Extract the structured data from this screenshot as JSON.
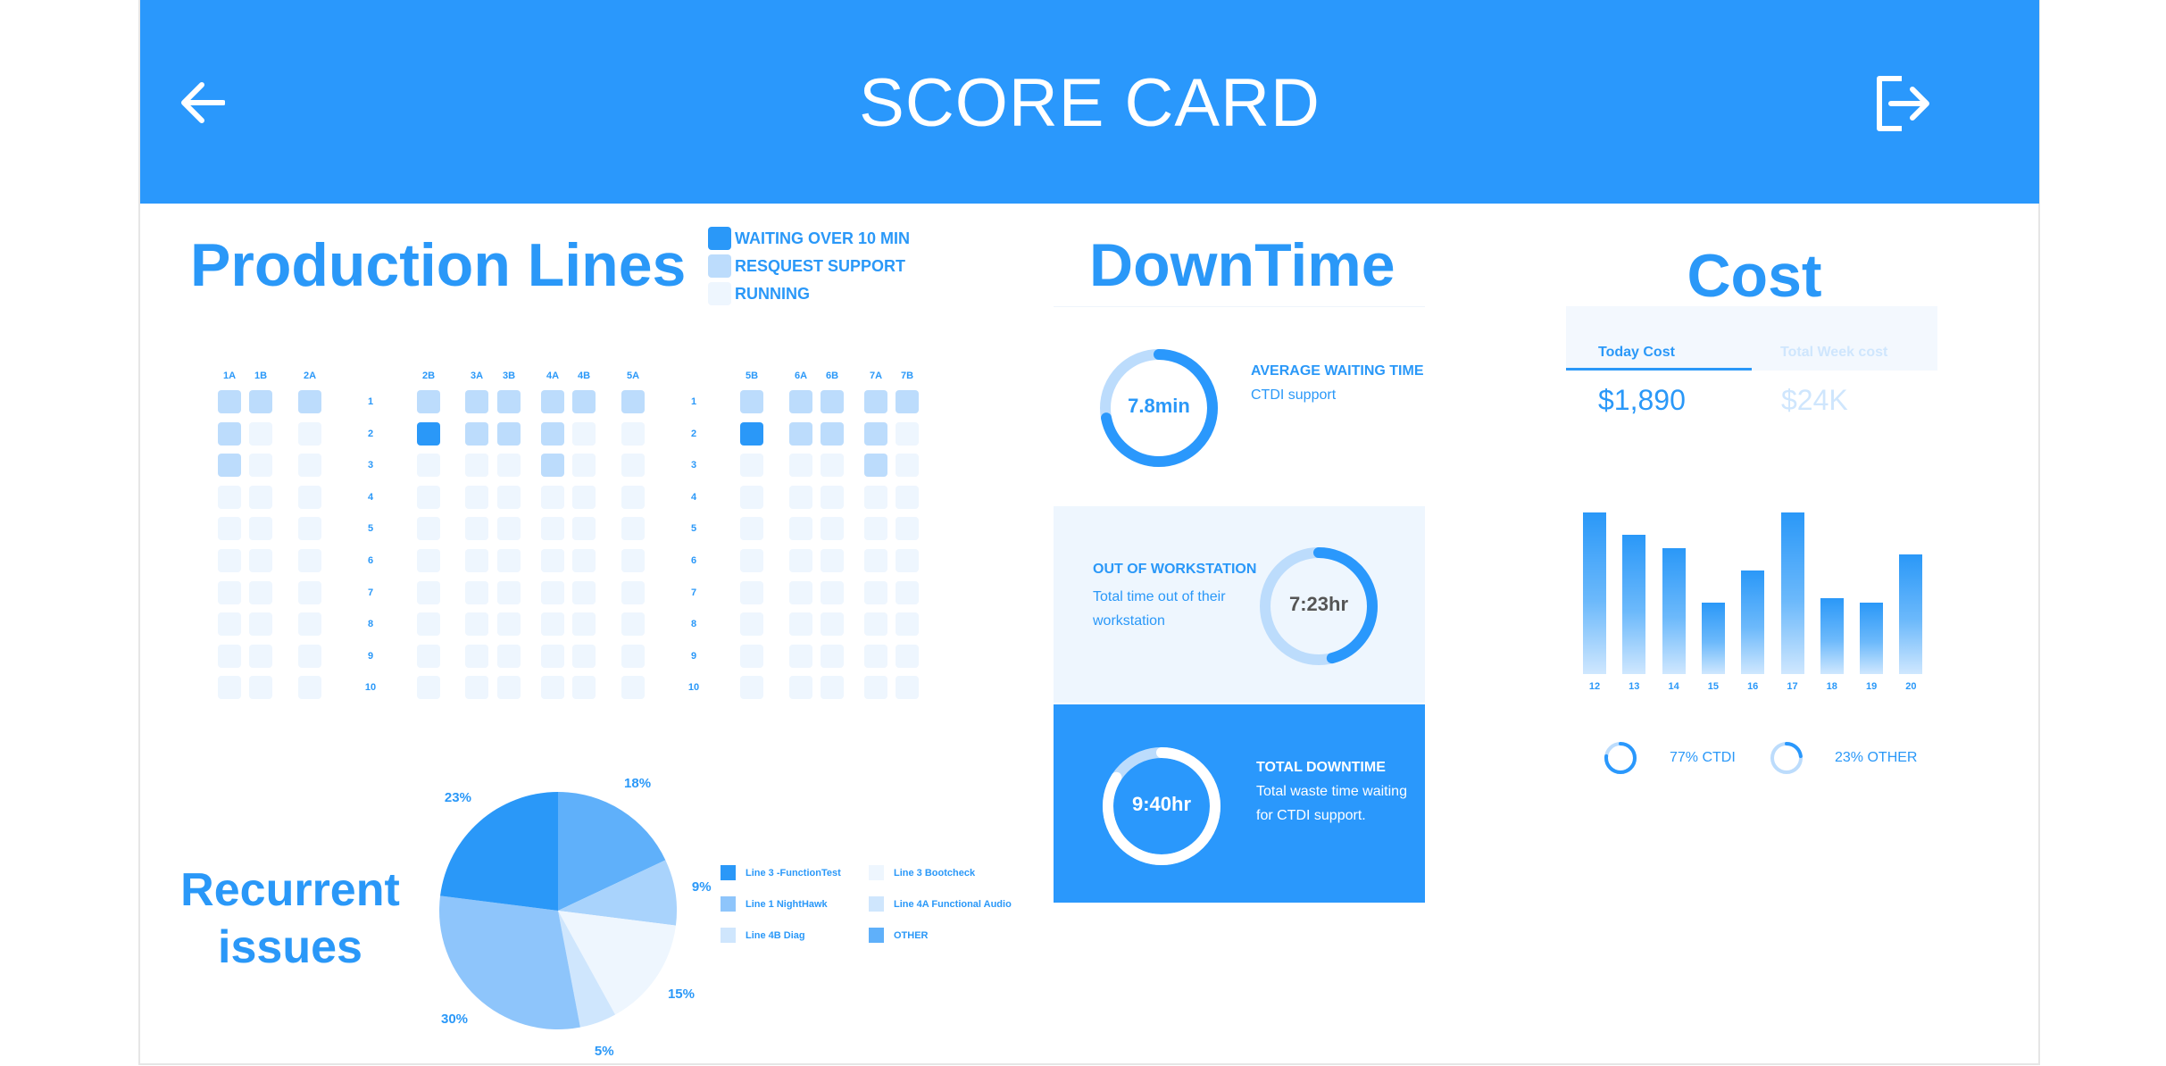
{
  "header": {
    "title": "SCORE CARD",
    "back_icon": "arrow-left-icon",
    "exit_icon": "logout-icon"
  },
  "colors": {
    "primary": "#2a98fc",
    "waiting": "#2a98f8",
    "request": "#bcdcfc",
    "running": "#eef6fe"
  },
  "production": {
    "title": "Production Lines",
    "legend": [
      {
        "label": "WAITING OVER 10 MIN",
        "status": "waiting"
      },
      {
        "label": "RESQUEST SUPPORT",
        "status": "request"
      },
      {
        "label": "RUNNING",
        "status": "running"
      }
    ],
    "row_numbers": [
      "1",
      "2",
      "3",
      "4",
      "5",
      "6",
      "7",
      "8",
      "9",
      "10"
    ],
    "groups": [
      {
        "columns": [
          {
            "label": "1A",
            "status": [
              "request",
              "request",
              "request",
              "running",
              "running",
              "running",
              "running",
              "running",
              "running",
              "running"
            ]
          },
          {
            "label": "1B",
            "status": [
              "request",
              "running",
              "running",
              "running",
              "running",
              "running",
              "running",
              "running",
              "running",
              "running"
            ]
          },
          {
            "label": "2A",
            "status": [
              "request",
              "running",
              "running",
              "running",
              "running",
              "running",
              "running",
              "running",
              "running",
              "running"
            ]
          }
        ]
      },
      {
        "columns": [
          {
            "label": "2B",
            "status": [
              "request",
              "waiting",
              "running",
              "running",
              "running",
              "running",
              "running",
              "running",
              "running",
              "running"
            ]
          },
          {
            "label": "3A",
            "status": [
              "request",
              "request",
              "running",
              "running",
              "running",
              "running",
              "running",
              "running",
              "running",
              "running"
            ]
          },
          {
            "label": "3B",
            "status": [
              "request",
              "request",
              "running",
              "running",
              "running",
              "running",
              "running",
              "running",
              "running",
              "running"
            ]
          },
          {
            "label": "4A",
            "status": [
              "request",
              "request",
              "request",
              "running",
              "running",
              "running",
              "running",
              "running",
              "running",
              "running"
            ]
          },
          {
            "label": "4B",
            "status": [
              "request",
              "running",
              "running",
              "running",
              "running",
              "running",
              "running",
              "running",
              "running",
              "running"
            ]
          },
          {
            "label": "5A",
            "status": [
              "request",
              "running",
              "running",
              "running",
              "running",
              "running",
              "running",
              "running",
              "running",
              "running"
            ]
          }
        ]
      },
      {
        "columns": [
          {
            "label": "5B",
            "status": [
              "request",
              "waiting",
              "running",
              "running",
              "running",
              "running",
              "running",
              "running",
              "running",
              "running"
            ]
          },
          {
            "label": "6A",
            "status": [
              "request",
              "request",
              "running",
              "running",
              "running",
              "running",
              "running",
              "running",
              "running",
              "running"
            ]
          },
          {
            "label": "6B",
            "status": [
              "request",
              "request",
              "running",
              "running",
              "running",
              "running",
              "running",
              "running",
              "running",
              "running"
            ]
          },
          {
            "label": "7A",
            "status": [
              "request",
              "request",
              "request",
              "running",
              "running",
              "running",
              "running",
              "running",
              "running",
              "running"
            ]
          },
          {
            "label": "7B",
            "status": [
              "request",
              "running",
              "running",
              "running",
              "running",
              "running",
              "running",
              "running",
              "running",
              "running"
            ]
          }
        ]
      }
    ]
  },
  "downtime": {
    "title": "DownTime",
    "average": {
      "value": "7.8min",
      "title": "AVERAGE WAITING TIME",
      "subtitle": "CTDI support",
      "fraction": 0.72
    },
    "out": {
      "value": "7:23hr",
      "title": "OUT OF WORKSTATION",
      "line1": "Total time out of their",
      "line2": "workstation",
      "fraction": 0.46
    },
    "total": {
      "value": "9:40hr",
      "title": "TOTAL DOWNTIME",
      "line1": "Total waste time waiting",
      "line2": "for CTDI support.",
      "fraction": 0.84
    }
  },
  "cost": {
    "title": "Cost",
    "tabs": [
      {
        "label": "Today Cost",
        "value": "$1,890",
        "active": true
      },
      {
        "label": "Total Week cost",
        "value": "$24K",
        "active": false
      }
    ],
    "split": [
      {
        "label": "77% CTDI",
        "fraction": 0.77
      },
      {
        "label": "23% OTHER",
        "fraction": 0.23
      }
    ]
  },
  "chart_data": [
    {
      "type": "bar",
      "categories": [
        "12",
        "13",
        "14",
        "15",
        "16",
        "17",
        "18",
        "19",
        "20"
      ],
      "values": [
        100,
        86,
        78,
        44,
        64,
        100,
        47,
        44,
        74
      ]
    },
    {
      "type": "pie",
      "title": "Recurrent issues",
      "labels": [
        "Line 3 -FunctionTest",
        "Line 1 NightHawk",
        "Line 4B Diag",
        "Line 3 Bootcheck",
        "Line 4A Functional Audio",
        "OTHER"
      ],
      "slice_labels": [
        "18%",
        "9%",
        "15%",
        "5%",
        "30%",
        "23%"
      ],
      "slice_values": [
        18,
        9,
        15,
        5,
        30,
        23
      ],
      "slice_colors": [
        "#5fb0fa",
        "#a9d3fc",
        "#eef6fe",
        "#cfe6fd",
        "#8ec5fb",
        "#2a98f8"
      ],
      "legend": [
        {
          "label": "Line 3 -FunctionTest",
          "color": "#2a98f8"
        },
        {
          "label": "Line 3 Bootcheck",
          "color": "#eef6fe"
        },
        {
          "label": "Line 1 NightHawk",
          "color": "#8ec5fb"
        },
        {
          "label": "Line 4A Functional Audio",
          "color": "#cfe6fd"
        },
        {
          "label": "Line 4B Diag",
          "color": "#cfe6fd"
        },
        {
          "label": "OTHER",
          "color": "#5fb0fa"
        }
      ]
    }
  ]
}
